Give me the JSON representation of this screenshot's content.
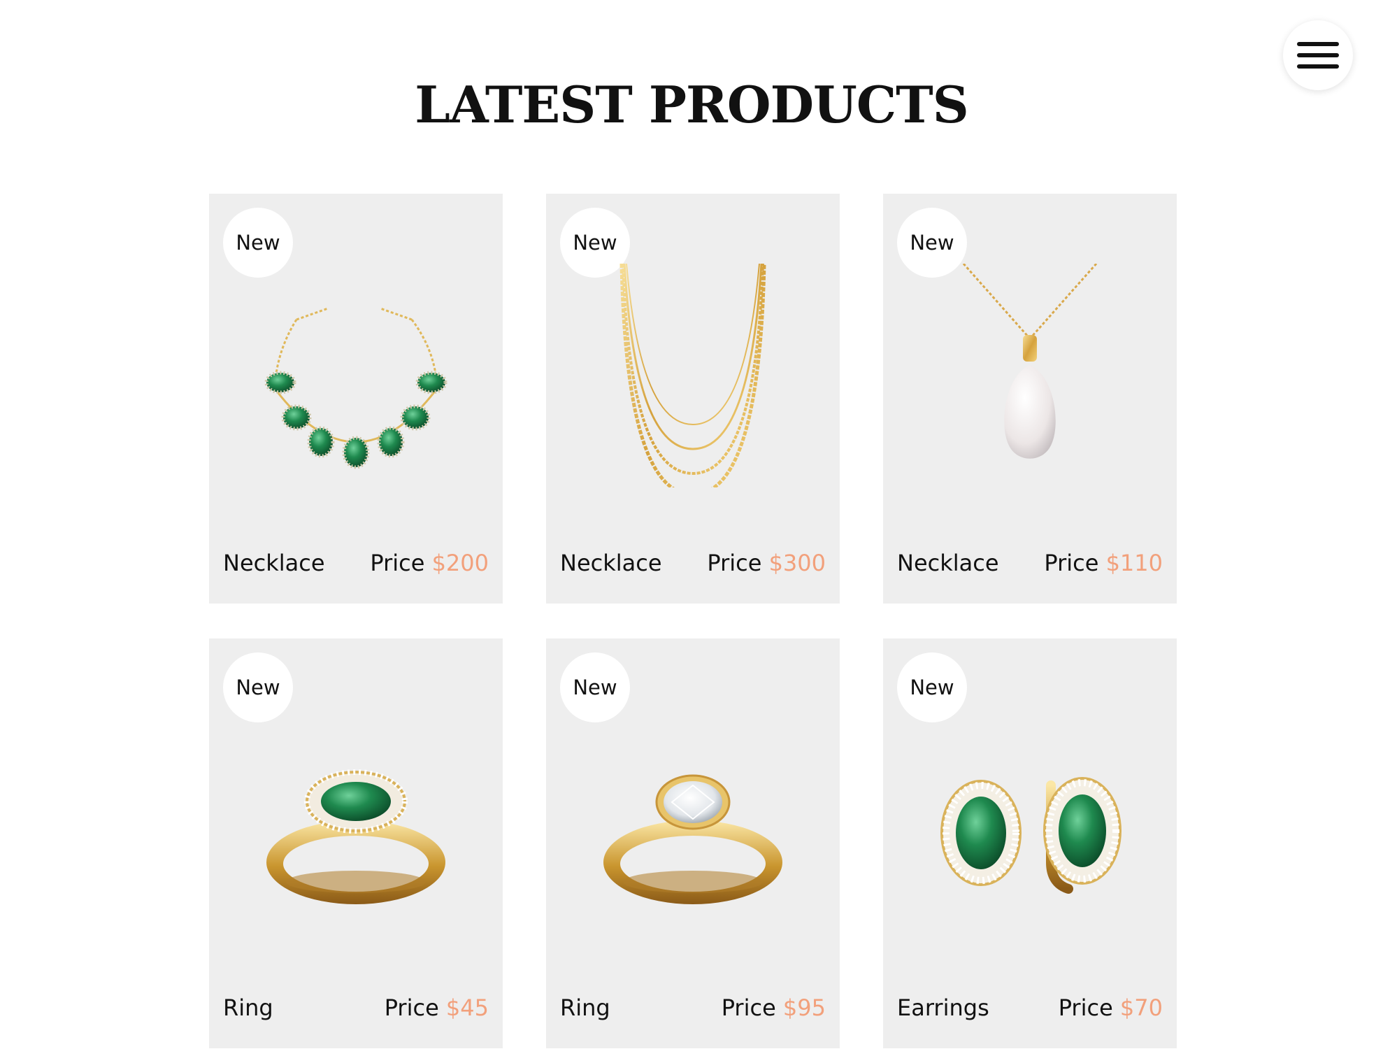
{
  "header": {
    "title": "LATEST PRODUCTS",
    "menu_icon": "hamburger-icon"
  },
  "colors": {
    "price_accent": "#f2a07b",
    "card_background": "#eeeeee"
  },
  "products": [
    {
      "badge": "New",
      "name": "Necklace",
      "price_label": "Price",
      "price": "$200",
      "image": "emerald-necklace-icon"
    },
    {
      "badge": "New",
      "name": "Necklace",
      "price_label": "Price",
      "price": "$300",
      "image": "gold-chain-necklace-icon"
    },
    {
      "badge": "New",
      "name": "Necklace",
      "price_label": "Price",
      "price": "$110",
      "image": "pearl-pendant-necklace-icon"
    },
    {
      "badge": "New",
      "name": "Ring",
      "price_label": "Price",
      "price": "$45",
      "image": "emerald-ring-icon"
    },
    {
      "badge": "New",
      "name": "Ring",
      "price_label": "Price",
      "price": "$95",
      "image": "diamond-ring-icon"
    },
    {
      "badge": "New",
      "name": "Earrings",
      "price_label": "Price",
      "price": "$70",
      "image": "emerald-earrings-icon"
    }
  ]
}
